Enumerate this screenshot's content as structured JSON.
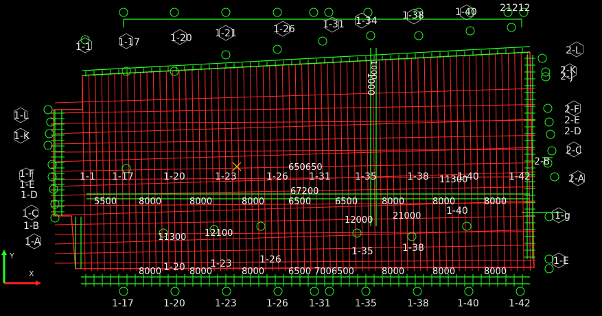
{
  "colors": {
    "background": "#000000",
    "grid": "#ff2a2a",
    "dimension": "#22ff22",
    "bubble": "#22ff22",
    "label": "#e8e8e8",
    "cursor": "#ffcc00",
    "ucs_x": "#ff2222",
    "ucs_y": "#22ff22"
  },
  "axes": {
    "top": [
      "1-17",
      "1-20",
      "1-21",
      "1-26",
      "1-31",
      "1-34",
      "1-38",
      "1-40",
      "21212"
    ],
    "bottom": [
      "1-17",
      "1-20",
      "1-23",
      "1-26",
      "1-31",
      "1-35",
      "1-38",
      "1-40",
      "1-42"
    ],
    "interior_row": [
      "1-1",
      "1-17",
      "1-20",
      "1-23",
      "1-26",
      "1-31",
      "1-35",
      "1-38",
      "1-40",
      "1-42"
    ],
    "interior_lower": [
      "1-20",
      "1-23",
      "1-26",
      "1-35",
      "1-38",
      "1-40"
    ],
    "top_left": "1-1",
    "left": [
      "1-L",
      "1-K",
      "1-F",
      "1-E",
      "1-D",
      "1-C",
      "1-B",
      "1-A"
    ],
    "right": [
      "2-L",
      "2-K",
      "2-J",
      "2-F",
      "2-E",
      "2-D",
      "2-C",
      "2-A",
      "2-B",
      "1-g",
      "1-E"
    ]
  },
  "dimensions": {
    "spans": [
      "5500",
      "8000",
      "8000",
      "8000",
      "6500",
      "6500",
      "8000",
      "8000",
      "8000"
    ],
    "bottom_spans": [
      "8000",
      "8000",
      "8000",
      "6500",
      "7006500",
      "8000",
      "8000",
      "8000"
    ],
    "misc": [
      "650650",
      "67200",
      "1000",
      "12000",
      "21000",
      "11300",
      "12100",
      "11300",
      "1000"
    ]
  },
  "ucs": {
    "x": "X",
    "y": "Y"
  }
}
